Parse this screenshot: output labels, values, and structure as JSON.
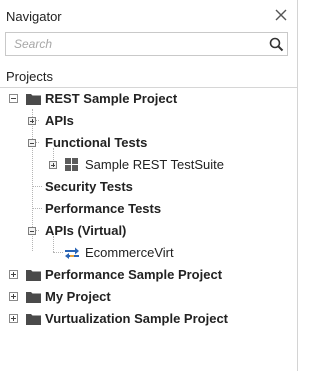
{
  "panel": {
    "title": "Navigator"
  },
  "search": {
    "placeholder": "Search",
    "value": ""
  },
  "section": {
    "label": "Projects"
  },
  "tree": {
    "project_rest": {
      "label": "REST Sample Project",
      "expanded": true,
      "children": {
        "apis": {
          "label": "APIs",
          "expanded": false
        },
        "functional_tests": {
          "label": "Functional Tests",
          "expanded": true,
          "children": {
            "suite": {
              "label": "Sample REST TestSuite",
              "expanded": false,
              "icon": "test-suite-icon"
            }
          }
        },
        "security_tests": {
          "label": "Security Tests"
        },
        "performance_tests": {
          "label": "Performance Tests"
        },
        "apis_virtual": {
          "label": "APIs (Virtual)",
          "expanded": true,
          "children": {
            "virt": {
              "label": "EcommerceVirt",
              "icon": "virt-service-icon"
            }
          }
        }
      }
    },
    "project_performance": {
      "label": "Performance Sample Project",
      "expanded": false
    },
    "project_my": {
      "label": "My Project",
      "expanded": false
    },
    "project_virtualization": {
      "label": "Vurtualization Sample Project",
      "expanded": false
    }
  },
  "colors": {
    "folder": "#4a4a4a",
    "virt_arrow_blue": "#2b65b5",
    "virt_arrow_accent": "#e8a33c",
    "divider": "#d6d6d6"
  }
}
